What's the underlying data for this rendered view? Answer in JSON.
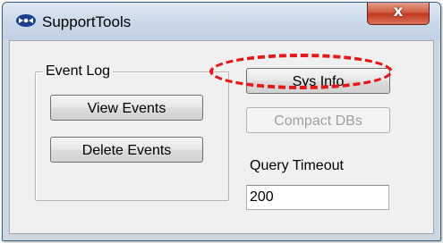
{
  "window": {
    "title": "SupportTools",
    "close_glyph": "x",
    "icon": "app-logo-icon",
    "colors": {
      "close": "#c8462b",
      "highlight": "#e41818"
    }
  },
  "event_log": {
    "group_label": "Event Log",
    "view_events": "View Events",
    "delete_events": "Delete Events"
  },
  "buttons": {
    "sys_info": "Sys Info",
    "compact_dbs": "Compact DBs"
  },
  "query_timeout": {
    "label": "Query Timeout",
    "value": "200"
  }
}
